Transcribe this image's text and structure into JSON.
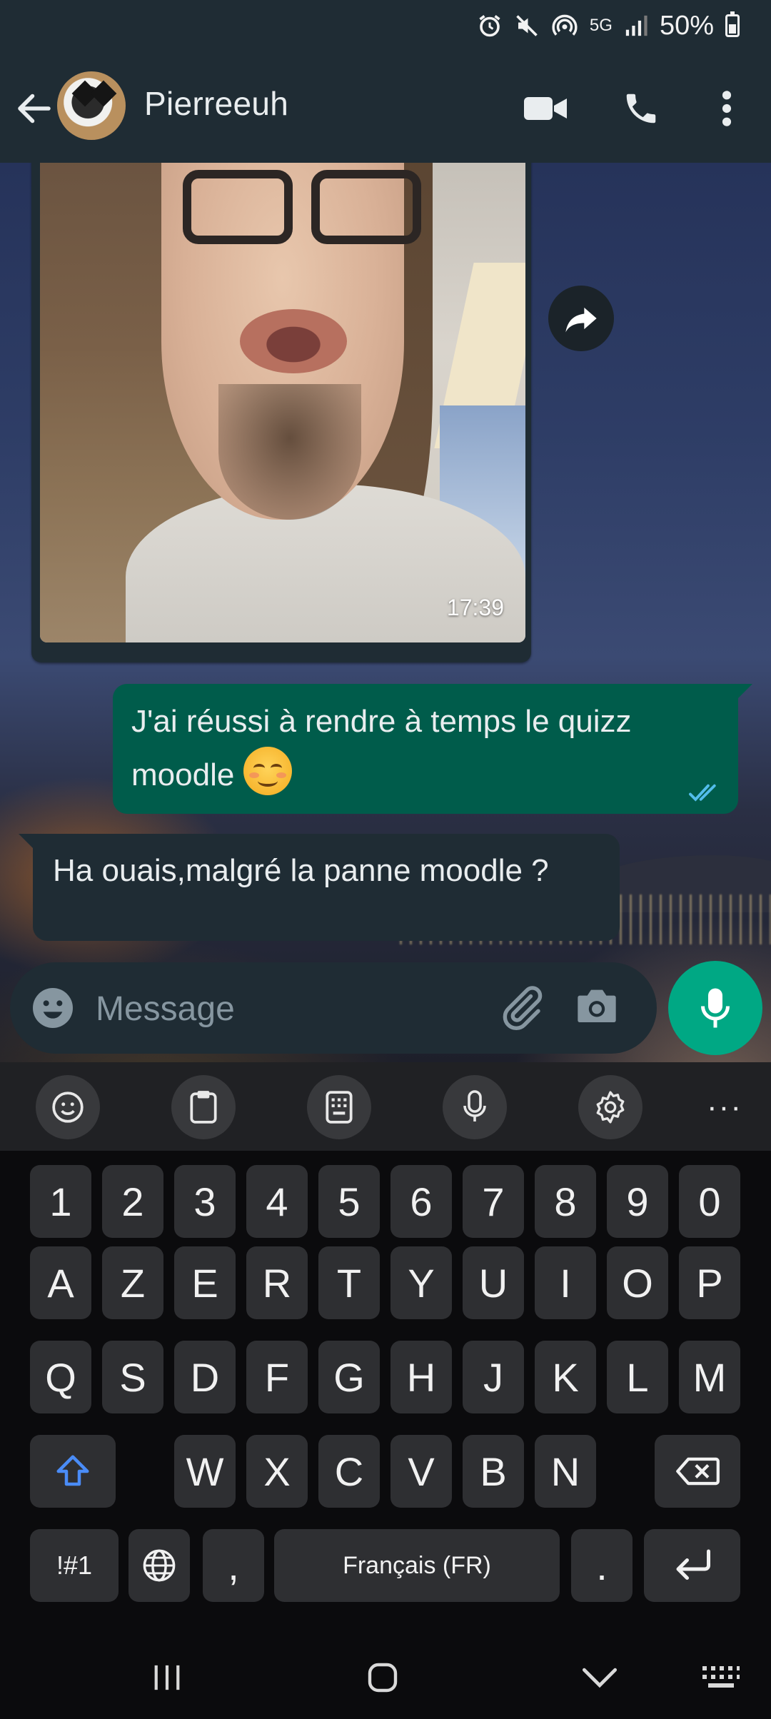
{
  "status_bar": {
    "network": "5G",
    "battery": "50%",
    "battery_level": 0.5,
    "icons": [
      "alarm-icon",
      "mute-icon",
      "hotspot-icon",
      "network-5g-icon",
      "signal-icon",
      "battery-icon"
    ]
  },
  "header": {
    "contact_name": "Pierreeuh",
    "icons": [
      "back-arrow-icon",
      "video-call-icon",
      "phone-call-icon",
      "more-options-icon"
    ]
  },
  "messages": [
    {
      "type": "image",
      "direction": "incoming",
      "time": "17:39"
    },
    {
      "type": "text",
      "direction": "outgoing",
      "text": "J'ai réussi à rendre à temps le quizz moodle",
      "emoji": "relieved-face",
      "status": "read"
    },
    {
      "type": "text",
      "direction": "incoming",
      "text": "Ha ouais,malgré la panne moodle ?"
    }
  ],
  "composer": {
    "placeholder": "Message",
    "icons": [
      "emoji-icon",
      "attach-icon",
      "camera-icon",
      "mic-icon"
    ]
  },
  "keyboard": {
    "toolbar": [
      "emoji-icon",
      "clipboard-icon",
      "keyboard-layout-icon",
      "voice-input-icon",
      "settings-icon",
      "more-icon"
    ],
    "toolbar_more": "···",
    "row_numbers": [
      "1",
      "2",
      "3",
      "4",
      "5",
      "6",
      "7",
      "8",
      "9",
      "0"
    ],
    "row1": [
      "A",
      "Z",
      "E",
      "R",
      "T",
      "Y",
      "U",
      "I",
      "O",
      "P"
    ],
    "row2": [
      "Q",
      "S",
      "D",
      "F",
      "G",
      "H",
      "J",
      "K",
      "L",
      "M"
    ],
    "row3": [
      "W",
      "X",
      "C",
      "V",
      "B",
      "N"
    ],
    "symbols_key": "!#1",
    "comma_key": ",",
    "space_label": "Français (FR)",
    "period_key": ".",
    "accent_color": "#4a8cf7"
  },
  "colors": {
    "header_bg": "#1f2c34",
    "outgoing_bubble": "#005c4b",
    "incoming_bubble": "#1f2c34",
    "mic_fab": "#00a884",
    "read_ticks": "#53bdeb"
  }
}
